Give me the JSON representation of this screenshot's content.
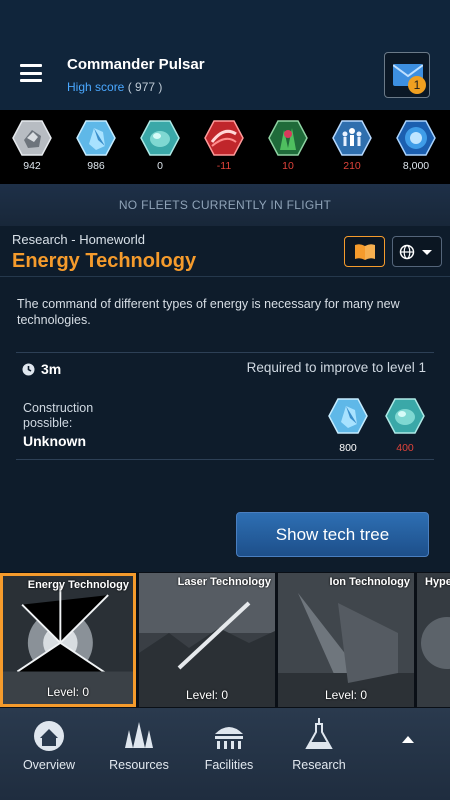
{
  "header": {
    "commander_name": "Commander Pulsar",
    "highscore_label": "High score",
    "highscore_value": "( 977 )",
    "mail_badge": "1"
  },
  "resources": [
    {
      "name": "metal",
      "icon": "metal-icon",
      "value": "942",
      "negative": false
    },
    {
      "name": "crystal",
      "icon": "crystal-icon",
      "value": "986",
      "negative": false
    },
    {
      "name": "deuterium",
      "icon": "deuterium-icon",
      "value": "0",
      "negative": false
    },
    {
      "name": "energy",
      "icon": "energy-icon",
      "value": "-11",
      "negative": true
    },
    {
      "name": "food",
      "icon": "food-icon",
      "value": "10",
      "negative": true
    },
    {
      "name": "population",
      "icon": "population-icon",
      "value": "210",
      "negative": true
    },
    {
      "name": "dark-matter",
      "icon": "dark-matter-icon",
      "value": "8,000",
      "negative": false
    }
  ],
  "fleet_status": "NO FLEETS CURRENTLY IN FLIGHT",
  "research": {
    "breadcrumb": "Research - Homeworld",
    "title": "Energy Technology",
    "description": "The command of different types of energy is necessary for many new technologies.",
    "time": "3m",
    "required_text": "Required to improve to level 1",
    "construction_label": "Construction possible:",
    "construction_value": "Unknown",
    "costs": [
      {
        "icon": "crystal-icon",
        "value": "800",
        "insufficient": false
      },
      {
        "icon": "deuterium-icon",
        "value": "400",
        "insufficient": true
      }
    ],
    "show_tree_label": "Show tech tree"
  },
  "tech_cards": [
    {
      "name": "Energy Technology",
      "level": "Level: 0",
      "selected": true
    },
    {
      "name": "Laser Technology",
      "level": "Level: 0",
      "selected": false
    },
    {
      "name": "Ion Technology",
      "level": "Level: 0",
      "selected": false
    },
    {
      "name": "Hype",
      "level": "",
      "selected": false
    }
  ],
  "nav": [
    {
      "label": "Overview",
      "icon": "home-icon"
    },
    {
      "label": "Resources",
      "icon": "crystals-icon"
    },
    {
      "label": "Facilities",
      "icon": "facilities-icon"
    },
    {
      "label": "Research",
      "icon": "flask-icon"
    }
  ],
  "colors": {
    "accent": "#f59b2c",
    "link": "#4aa8ff",
    "negative": "#e0433a",
    "button_blue": "#2e6fb3"
  }
}
